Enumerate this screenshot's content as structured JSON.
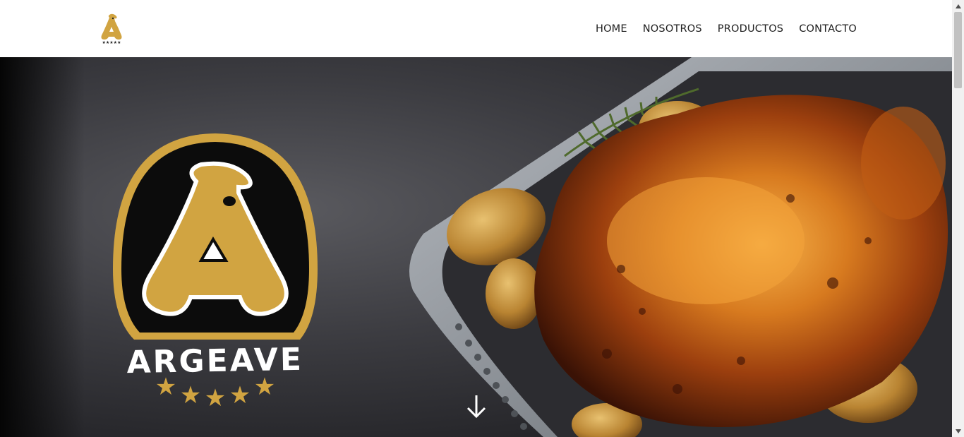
{
  "header": {
    "logo_icon": "argeave-small-logo",
    "nav": [
      {
        "label": "HOME"
      },
      {
        "label": "NOSOTROS"
      },
      {
        "label": "PRODUCTOS"
      },
      {
        "label": "CONTACTO"
      }
    ]
  },
  "hero": {
    "brand_name": "ARGEAVE",
    "stars": 5,
    "scroll_icon": "arrow-down-icon"
  },
  "colors": {
    "gold": "#d1a441",
    "dark": "#0c0c0c",
    "nav_text": "#1d1d1d"
  }
}
